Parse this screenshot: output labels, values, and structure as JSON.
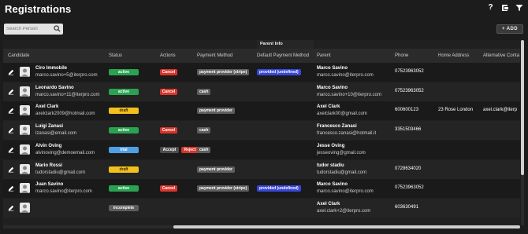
{
  "app": {
    "title": "Registrations"
  },
  "top_icons": [
    "help-icon",
    "export-icon",
    "filter-icon"
  ],
  "search": {
    "placeholder": "Search Person",
    "value": ""
  },
  "add_button": {
    "label": "+ ADD"
  },
  "group_header": "Parent Info",
  "columns": [
    "Candidate",
    "Status",
    "Actions",
    "Payment Method",
    "Default Payment Method",
    "Parent",
    "Phone",
    "Home Address",
    "Alternative Conta"
  ],
  "colors": {
    "active": "#2aa251",
    "draft": "#f2c01c",
    "trial": "#4f9fe6",
    "incomplete": "#5d5d5d",
    "cancel": "#d9342b",
    "default_pm": "#3747d8"
  },
  "rows": [
    {
      "name": "Ciro Immobile",
      "email": "marco.savino+5@iterpro.com",
      "status": "active",
      "actions": [
        "Cancel"
      ],
      "payment_method": "payment provider (stripe)",
      "default_pm": "provided (undefined)",
      "parent_name": "Marco Savino",
      "parent_email": "marco.savino@iterpro.com",
      "phone": "07523963052",
      "address": "",
      "alt_contact": ""
    },
    {
      "name": "Leonardo Savino",
      "email": "marco.savino+11@iterpro.com",
      "status": "active",
      "actions": [
        "Cancel"
      ],
      "payment_method": "cash",
      "default_pm": "",
      "parent_name": "Marco Savino",
      "parent_email": "marco.savino+10@iterpro.com",
      "phone": "07523963052",
      "address": "",
      "alt_contact": ""
    },
    {
      "name": "Axel Clark",
      "email": "axelclark2009@hotmail.com",
      "status": "draft",
      "actions": [],
      "payment_method": "payment provider",
      "default_pm": "",
      "parent_name": "Axel Clark",
      "parent_email": "axelclark00@gmail.com",
      "phone": "600600123",
      "address": "23 Rose London",
      "alt_contact": "axel.clark@iterp"
    },
    {
      "name": "Luigi Zanasi",
      "email": "lzanasi@email.com",
      "status": "active",
      "actions": [
        "Cancel"
      ],
      "payment_method": "cash",
      "default_pm": "",
      "parent_name": "Francesco Zanasi",
      "parent_email": "francesco.zanasi@hotmail.it",
      "phone": "3351503466",
      "address": "",
      "alt_contact": ""
    },
    {
      "name": "Alvin Oving",
      "email": "alvinoving@demoemail.com",
      "status": "trial",
      "actions": [
        "Accept",
        "Reject"
      ],
      "payment_method": "cash",
      "default_pm": "",
      "parent_name": "Jesse Oving",
      "parent_email": "jesseoving@gmail.com",
      "phone": "",
      "address": "",
      "alt_contact": ""
    },
    {
      "name": "Mario Rossi",
      "email": "tudorstadiu@gmail.com",
      "status": "draft",
      "actions": [],
      "payment_method": "payment provider",
      "default_pm": "",
      "parent_name": "tudor stadiu",
      "parent_email": "tudorstadiu@gmail.com",
      "phone": "0728634020",
      "address": "",
      "alt_contact": ""
    },
    {
      "name": "Juan Savino",
      "email": "marco.savino@iterpro.com",
      "status": "active",
      "actions": [
        "Cancel"
      ],
      "payment_method": "payment provider (stripe)",
      "default_pm": "provided (undefined)",
      "parent_name": "Marco Savino",
      "parent_email": "marco.savino@iterpro.com",
      "phone": "07523963052",
      "address": "",
      "alt_contact": ""
    },
    {
      "name": "",
      "email": "",
      "status": "incomplete",
      "actions": [],
      "payment_method": "",
      "default_pm": "",
      "parent_name": "Axel Clark",
      "parent_email": "axel.clark+2@iterpro.com",
      "phone": "603630491",
      "address": "",
      "alt_contact": ""
    }
  ]
}
